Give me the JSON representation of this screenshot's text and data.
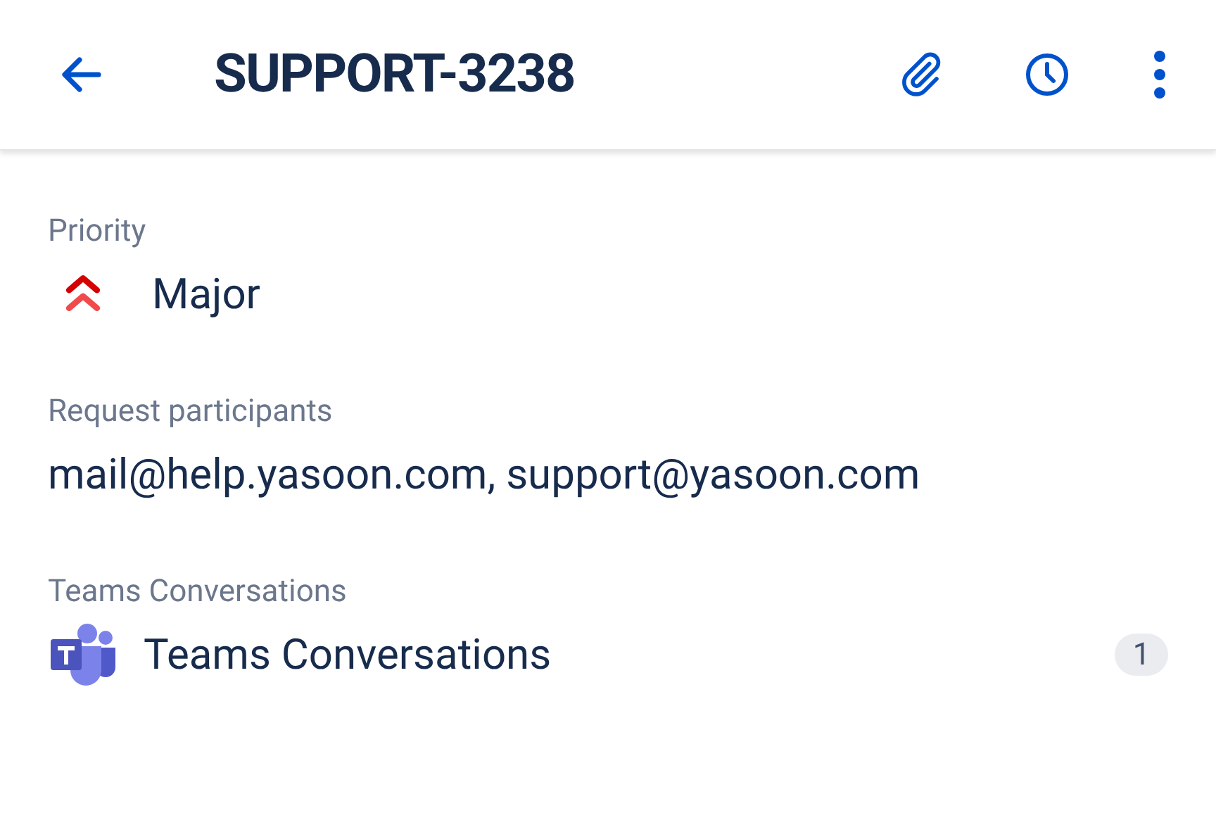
{
  "header": {
    "title": "SUPPORT-3238"
  },
  "fields": [
    {
      "kind": "priority",
      "label": "Priority",
      "value": "Major"
    },
    {
      "kind": "text",
      "label": "Request participants",
      "value": "mail@help.yasoon.com, support@yasoon.com"
    },
    {
      "kind": "teams",
      "label": "Teams Conversations",
      "value": "Teams Conversations",
      "count": "1"
    }
  ]
}
